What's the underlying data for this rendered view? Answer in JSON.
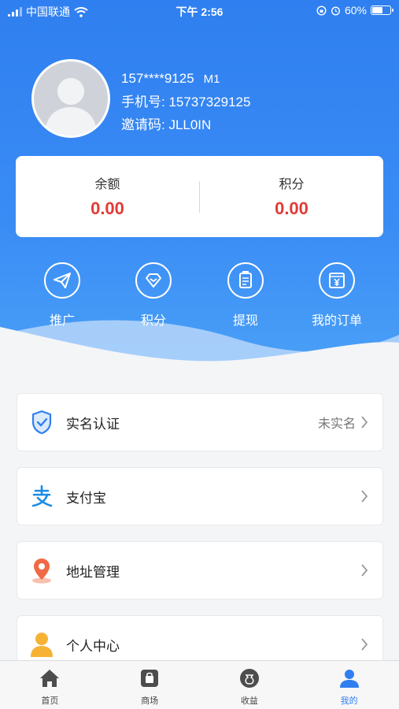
{
  "status_bar": {
    "carrier": "中国联通",
    "time": "下午 2:56",
    "battery_text": "60%",
    "battery_level": 0.6
  },
  "profile": {
    "masked_phone": "157****9125",
    "level": "M1",
    "phone_line": "手机号: 15737329125",
    "invite_line": "邀请码: JLL0IN"
  },
  "summary": {
    "balance_label": "余额",
    "balance_value": "0.00",
    "points_label": "积分",
    "points_value": "0.00"
  },
  "quick_actions": [
    {
      "label": "推广",
      "icon": "paper-plane-icon"
    },
    {
      "label": "积分",
      "icon": "diamond-icon"
    },
    {
      "label": "提现",
      "icon": "clipboard-icon"
    },
    {
      "label": "我的订单",
      "icon": "yen-order-icon"
    }
  ],
  "menu": [
    {
      "label": "实名认证",
      "value": "未实名",
      "icon": "shield-check-icon"
    },
    {
      "label": "支付宝",
      "value": "",
      "icon": "alipay-icon"
    },
    {
      "label": "地址管理",
      "value": "",
      "icon": "location-pin-icon"
    },
    {
      "label": "个人中心",
      "value": "",
      "icon": "person-icon"
    }
  ],
  "tabs": [
    {
      "label": "首页",
      "icon": "home-icon"
    },
    {
      "label": "商场",
      "icon": "shopping-bag-icon"
    },
    {
      "label": "收益",
      "icon": "money-bag-icon"
    },
    {
      "label": "我的",
      "icon": "user-icon",
      "active": true
    }
  ],
  "colors": {
    "accent": "#2f7ff0",
    "value_red": "#e23a36"
  }
}
